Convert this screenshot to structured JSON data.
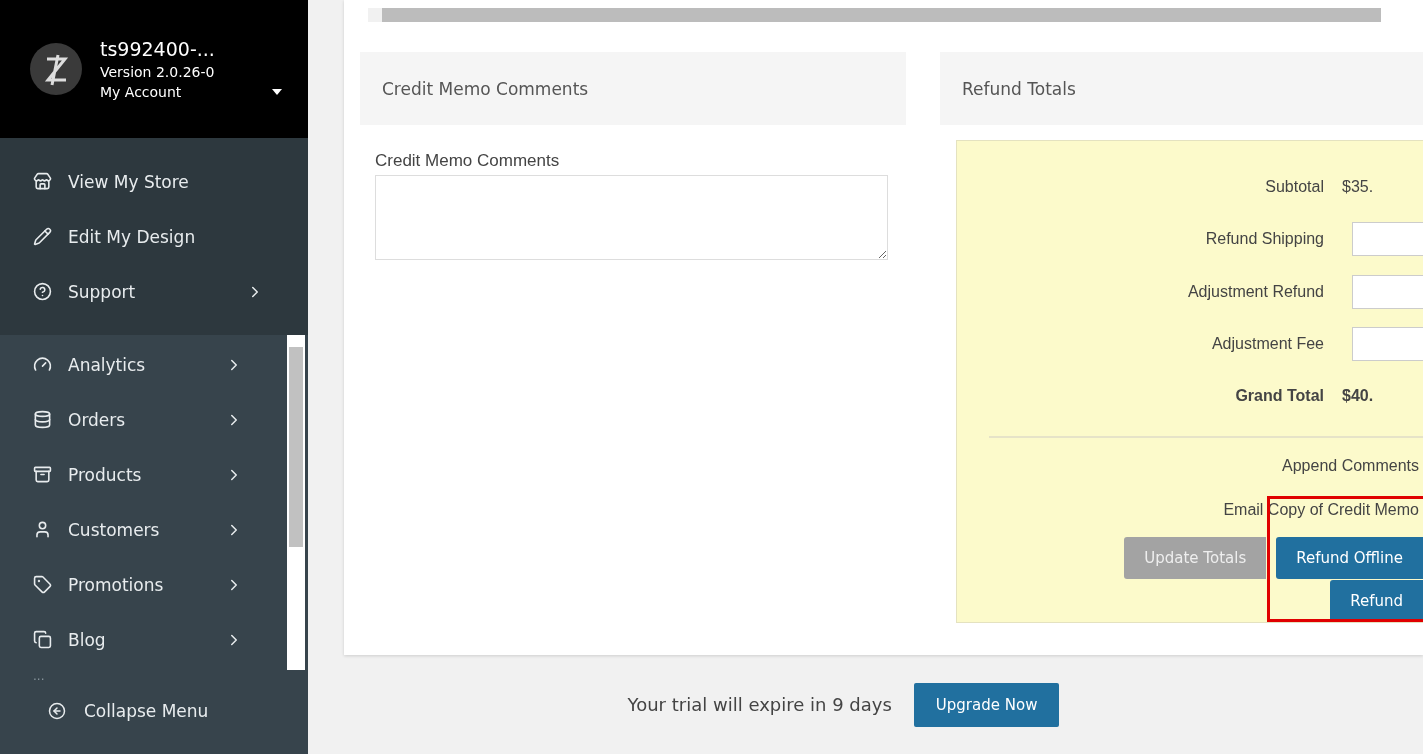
{
  "account": {
    "store_name": "ts992400-...",
    "version": "Version 2.0.26-0",
    "menu_label": "My Account"
  },
  "top_menu": [
    {
      "label": "View My Store",
      "has_submenu": false
    },
    {
      "label": "Edit My Design",
      "has_submenu": false
    },
    {
      "label": "Support",
      "has_submenu": true
    }
  ],
  "nav": [
    {
      "label": "Analytics",
      "has_submenu": true
    },
    {
      "label": "Orders",
      "has_submenu": true
    },
    {
      "label": "Products",
      "has_submenu": true
    },
    {
      "label": "Customers",
      "has_submenu": true
    },
    {
      "label": "Promotions",
      "has_submenu": true
    },
    {
      "label": "Blog",
      "has_submenu": true
    }
  ],
  "nav_more": "...",
  "collapse_label": "Collapse Menu",
  "comments_panel": {
    "title": "Credit Memo Comments",
    "field_label": "Credit Memo Comments"
  },
  "totals_panel": {
    "title": "Refund Totals",
    "rows": [
      {
        "kind": "value",
        "label": "Subtotal",
        "value": "$35."
      },
      {
        "kind": "input",
        "label": "Refund Shipping"
      },
      {
        "kind": "input",
        "label": "Adjustment Refund"
      },
      {
        "kind": "input",
        "label": "Adjustment Fee"
      },
      {
        "kind": "total",
        "label": "Grand Total",
        "value": "$40."
      }
    ],
    "options": [
      "Append Comments",
      "Email Copy of Credit Memo"
    ],
    "buttons": [
      {
        "label": "Update Totals",
        "disabled": true
      },
      {
        "label": "Refund Offline",
        "disabled": false
      },
      {
        "label": "Refund",
        "disabled": false
      }
    ],
    "highlighted": true
  },
  "trial": {
    "message": "Your trial will expire in 9 days",
    "button": "Upgrade Now"
  }
}
